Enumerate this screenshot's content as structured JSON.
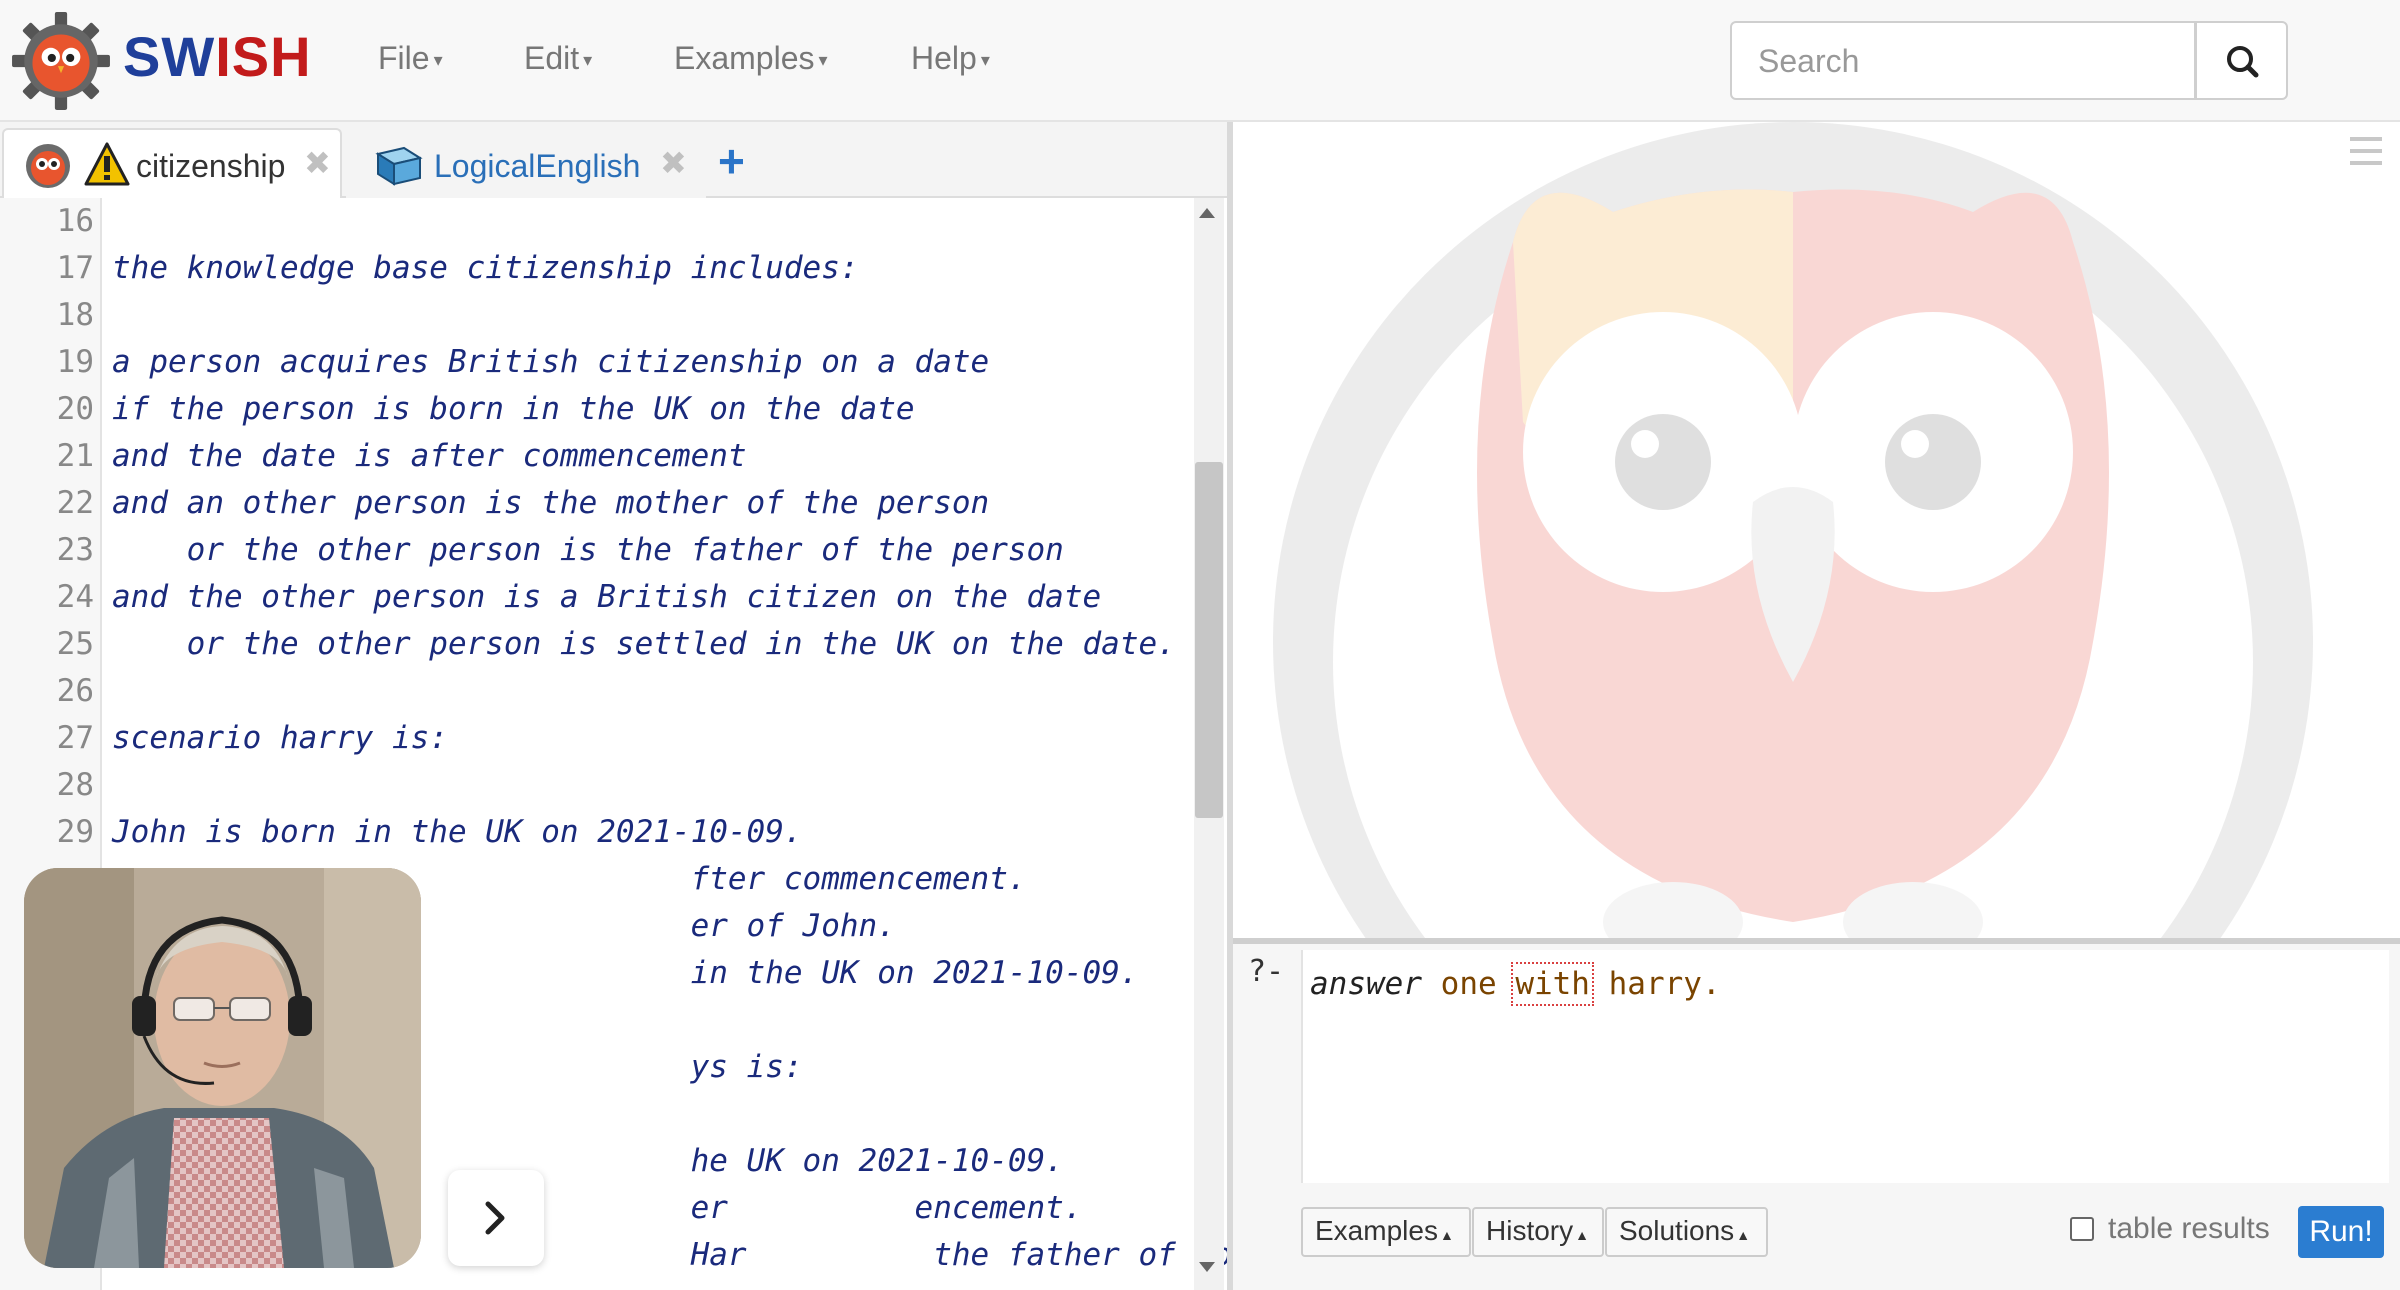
{
  "app": {
    "brand_sw": "SW",
    "brand_ish": "ISH"
  },
  "navbar": {
    "menus": [
      {
        "label": "File"
      },
      {
        "label": "Edit"
      },
      {
        "label": "Examples"
      },
      {
        "label": "Help"
      }
    ],
    "search": {
      "placeholder": "Search"
    }
  },
  "tabs": [
    {
      "label": "citizenship",
      "active": true
    },
    {
      "label": "LogicalEnglish",
      "active": false
    }
  ],
  "editor": {
    "lines": [
      {
        "n": "16",
        "text": ""
      },
      {
        "n": "17",
        "text": "the knowledge base citizenship includes:"
      },
      {
        "n": "18",
        "text": ""
      },
      {
        "n": "19",
        "text": "a person acquires British citizenship on a date"
      },
      {
        "n": "20",
        "text": "if the person is born in the UK on the date"
      },
      {
        "n": "21",
        "text": "and the date is after commencement"
      },
      {
        "n": "22",
        "text": "and an other person is the mother of the person"
      },
      {
        "n": "23",
        "text": "    or the other person is the father of the person"
      },
      {
        "n": "24",
        "text": "and the other person is a British citizen on the date"
      },
      {
        "n": "25",
        "text": "    or the other person is settled in the UK on the date."
      },
      {
        "n": "26",
        "text": ""
      },
      {
        "n": "27",
        "text": "scenario harry is:"
      },
      {
        "n": "28",
        "text": ""
      },
      {
        "n": "29",
        "text": "John is born in the UK on 2021-10-09."
      },
      {
        "n": "",
        "text": "                               fter commencement."
      },
      {
        "n": "",
        "text": "                               er of John."
      },
      {
        "n": "",
        "text": "                               in the UK on 2021-10-09."
      },
      {
        "n": "",
        "text": ""
      },
      {
        "n": "",
        "text": "                               ys is:"
      },
      {
        "n": "",
        "text": ""
      },
      {
        "n": "",
        "text": "                               he UK on 2021-10-09."
      },
      {
        "n": "",
        "text": "                               er          encement."
      },
      {
        "n": "",
        "text": "                               Har          the father of John."
      }
    ]
  },
  "query": {
    "prompt": "?-",
    "tokens": [
      {
        "text": "answer ",
        "kind": "atom"
      },
      {
        "text": "one ",
        "kind": "word"
      },
      {
        "text": "with",
        "kind": "highlight"
      },
      {
        "text": " harry.",
        "kind": "word"
      }
    ]
  },
  "query_buttons": [
    {
      "label": "Examples"
    },
    {
      "label": "History"
    },
    {
      "label": "Solutions"
    }
  ],
  "table_results_label": "table results",
  "run_label": "Run!",
  "colors": {
    "brand_blue": "#1f3f9a",
    "brand_red": "#c21b1b",
    "code": "#1a2a7c",
    "run": "#2b7dd1"
  }
}
